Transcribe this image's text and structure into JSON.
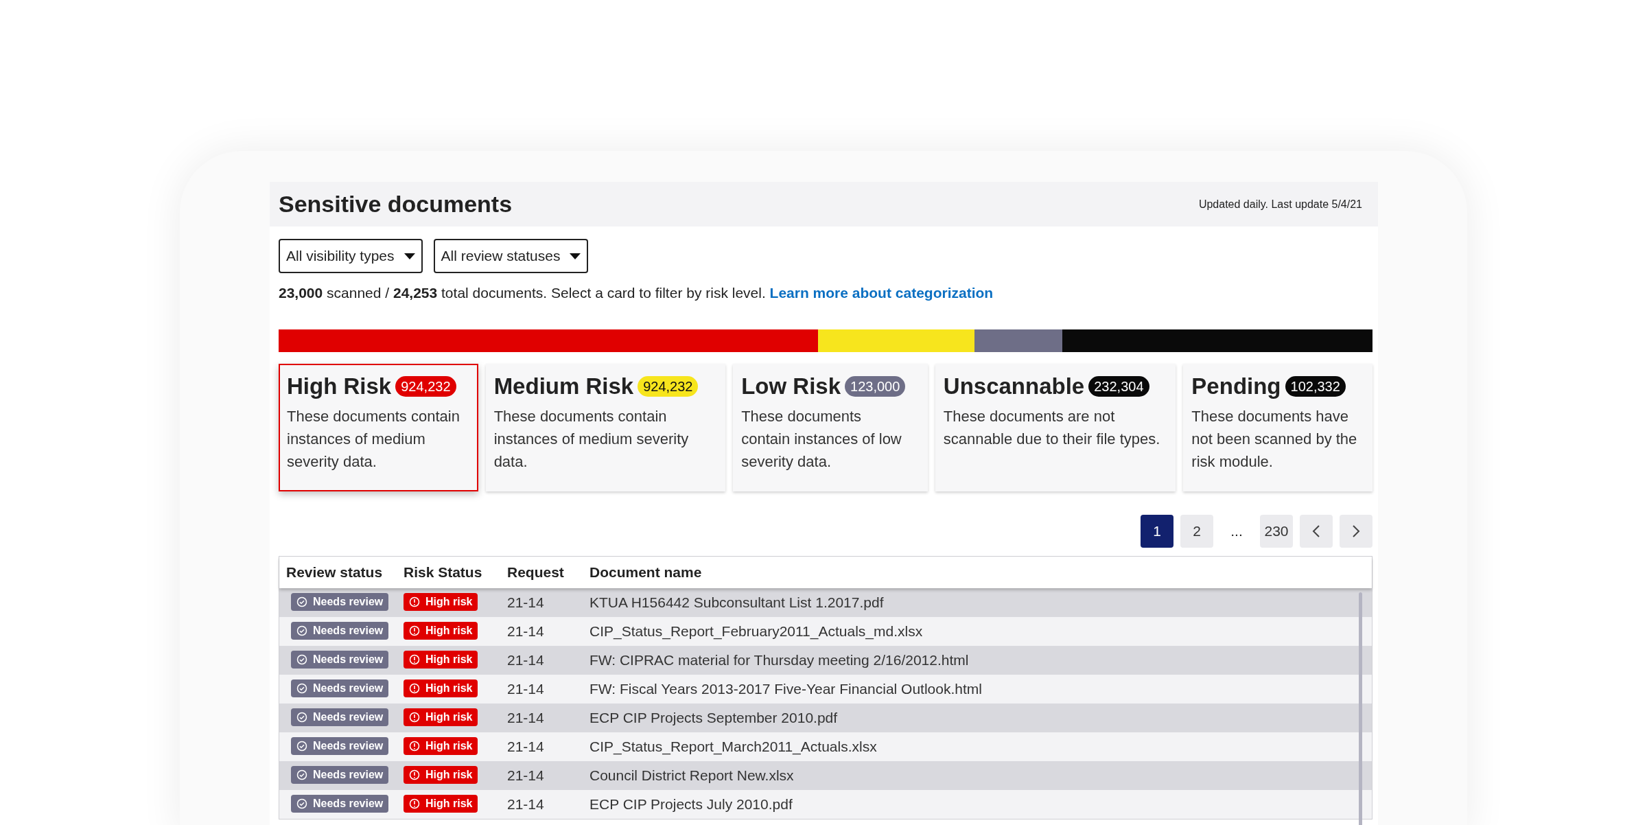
{
  "header": {
    "title": "Sensitive documents",
    "updated": "Updated daily. Last update 5/4/21"
  },
  "filters": [
    {
      "label": "All visibility types"
    },
    {
      "label": "All review statuses"
    }
  ],
  "summary": {
    "text": "**23,000** scanned / **24,253** total documents. Select a card to filter by risk level.",
    "link": "Learn more about categorization"
  },
  "risk_bar": [
    {
      "color": "#e00000"
    },
    {
      "color": "#f7e51d"
    },
    {
      "color": "#6e6e87"
    },
    {
      "color": "#0a0a0a"
    }
  ],
  "cards": [
    {
      "title": "High Risk",
      "count": "924,232",
      "color": "#e00000",
      "selected": true,
      "description": "These documents contain instances of medium severity data."
    },
    {
      "title": "Medium Risk",
      "count": "924,232",
      "color": "#f7e51d",
      "selected": false,
      "description": "These documents contain instances of medium severity data."
    },
    {
      "title": "Low Risk",
      "count": "123,000",
      "color": "#6e6e87",
      "selected": false,
      "description": "These documents contain instances of low severity data."
    },
    {
      "title": "Unscannable",
      "count": "232,304",
      "color": "#0a0a0a",
      "selected": false,
      "description": "These documents are not scannable due to their file types."
    },
    {
      "title": "Pending",
      "count": "102,332",
      "color": "#0a0a0a",
      "selected": false,
      "description": "These documents have not been scanned by the risk module."
    }
  ],
  "pagination": [
    {
      "label": "1",
      "selected": true
    },
    {
      "label": "2",
      "selected": false
    },
    {
      "label": "...",
      "kind": "gap"
    },
    {
      "label": "230",
      "selected": false
    }
  ],
  "table": {
    "columns": [
      "Review status",
      "Risk Status",
      "Request",
      "Document name"
    ],
    "rows": [
      {
        "review": "Needs review",
        "risk": "High risk",
        "request": "21-14",
        "name": "KTUA H156442 Subconsultant List 1.2017.pdf"
      },
      {
        "review": "Needs review",
        "risk": "High risk",
        "request": "21-14",
        "name": "CIP_Status_Report_February2011_Actuals_md.xlsx"
      },
      {
        "review": "Needs review",
        "risk": "High risk",
        "request": "21-14",
        "name": "FW: CIPRAC material for Thursday meeting 2/16/2012.html"
      },
      {
        "review": "Needs review",
        "risk": "High risk",
        "request": "21-14",
        "name": "FW: Fiscal Years 2013-2017 Five-Year Financial Outlook.html"
      },
      {
        "review": "Needs review",
        "risk": "High risk",
        "request": "21-14",
        "name": "ECP CIP Projects September 2010.pdf"
      },
      {
        "review": "Needs review",
        "risk": "High risk",
        "request": "21-14",
        "name": "CIP_Status_Report_March2011_Actuals.xlsx"
      },
      {
        "review": "Needs review",
        "risk": "High risk",
        "request": "21-14",
        "name": "Council District Report New.xlsx"
      },
      {
        "review": "Needs review",
        "risk": "High risk",
        "request": "21-14",
        "name": "ECP CIP Projects July 2010.pdf"
      }
    ]
  }
}
